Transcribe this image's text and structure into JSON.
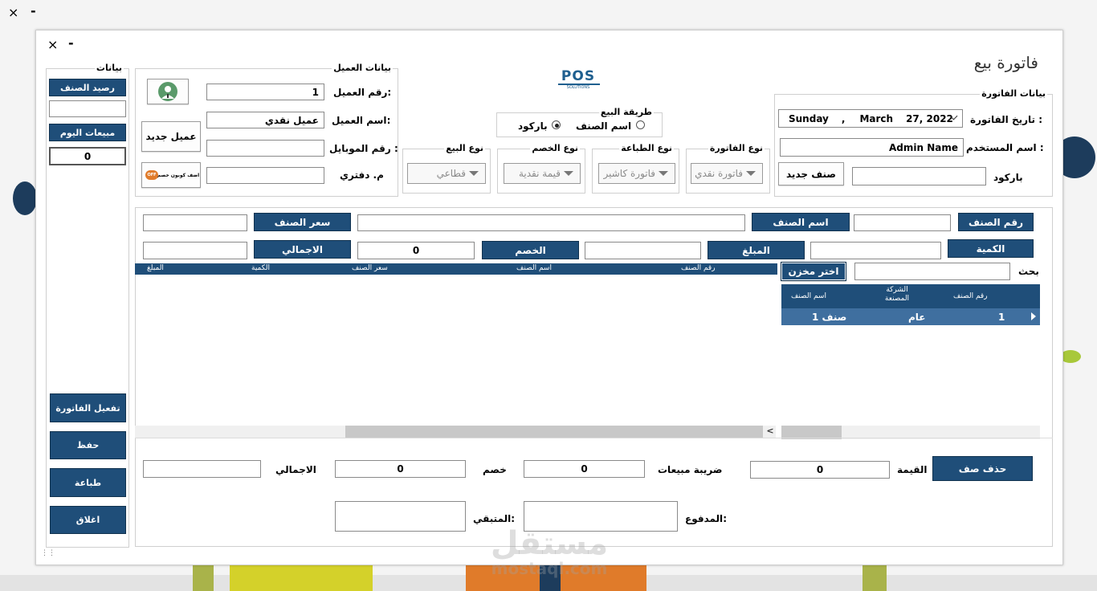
{
  "os_controls": {
    "close": "×",
    "minimize": "-"
  },
  "window": {
    "close": "×",
    "minimize": "-",
    "title": "فاتورة بيع",
    "logo": "POS",
    "logo_sub": "SOLUTIONS"
  },
  "sidebar": {
    "title": "بيانات",
    "item_balance_btn": "رصيد الصنف",
    "item_balance_value": "",
    "today_sales_btn": "مبيعات اليوم",
    "today_sales_value": "0",
    "activate_btn": "تفعيل الفاتورة",
    "save_btn": "حفظ",
    "print_btn": "طباعة",
    "close_btn": "اغلاق"
  },
  "customer": {
    "title": "بيانات العميل",
    "number_label": "رقم العميل:",
    "number_value": "1",
    "name_label": "اسم العميل:",
    "name_value": "عميل نقدي",
    "mobile_label": "رقم الموبايل :",
    "mobile_value": "",
    "notebook_label": "م. دفتري",
    "notebook_value": "",
    "new_customer_btn": "عميل جديد",
    "coupon_btn": "اضف كوبون خصم",
    "coupon_badge": "OFF"
  },
  "sale_method": {
    "title": "طريقة البيع",
    "option_name": "اسم الصنف",
    "option_barcode": "باركود",
    "selected": "باركود"
  },
  "invoice_type": {
    "title": "نوع الفاتورة",
    "value": "فاتورة نقدي"
  },
  "print_type": {
    "title": "نوع الطباعة",
    "value": "فاتورة كاشير"
  },
  "discount_type": {
    "title": "نوع الخصم",
    "value": "قيمة نقدية"
  },
  "sale_type": {
    "title": "نوع البيع",
    "value": "قطاعي"
  },
  "invoice_data": {
    "title": "بيانات الفاتورة",
    "date_label": "تاريخ الفاتورة :",
    "date_day": "Sunday",
    "date_sep": ",",
    "date_month": "March",
    "date_rest": "27, 2022",
    "user_label": "اسم المستخدم :",
    "user_value": "Admin Name",
    "barcode_label": "باركود",
    "barcode_value": "",
    "new_item_btn": "صنف جديد"
  },
  "item_entry": {
    "item_no_btn": "رقم الصنف",
    "item_no_value": "",
    "item_name_btn": "اسم الصنف",
    "item_name_value": "",
    "item_price_btn": "سعر الصنف",
    "item_price_value": "",
    "qty_btn": "الكمية",
    "qty_value": "",
    "amount_btn": "المبلغ",
    "amount_value": "",
    "discount_btn": "الخصم",
    "discount_value": "0",
    "total_btn": "الاجمالي",
    "total_value": ""
  },
  "invoice_grid": {
    "columns": [
      "رقم الصنف",
      "اسم الصنف",
      "سعر الصنف",
      "الكمية",
      "المبلغ"
    ],
    "scroll_left": "<"
  },
  "search": {
    "label": "بحث",
    "value": "",
    "warehouse_btn": "اختر مخزن",
    "columns": [
      "رقم الصنف",
      "الشركة المصنعة",
      "اسم الصنف"
    ],
    "rows": [
      {
        "no": "1",
        "company": "عام",
        "name": "صنف 1"
      }
    ]
  },
  "totals": {
    "delete_btn": "حذف صف",
    "value_label": "القيمة",
    "value": "0",
    "tax_label": "ضريبة مبيعات",
    "tax_value": "0",
    "discount_label": "خصم",
    "discount_value": "0",
    "total_label": "الاجمالي",
    "total_value": "",
    "paid_label": "المدفوع:",
    "paid_value": "",
    "remaining_label": "المتبقي:",
    "remaining_value": ""
  },
  "watermark": {
    "ar": "مستقل",
    "en": "mostaql.com"
  }
}
